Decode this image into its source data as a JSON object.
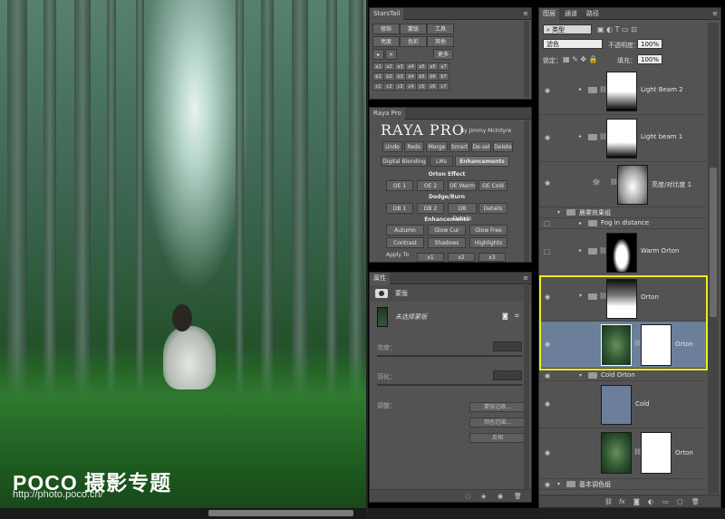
{
  "photo": {
    "watermark_logo": "POCO 摄影专题",
    "watermark_url": "http://photo.poco.cn/"
  },
  "starstail": {
    "title": "StarsTail",
    "row1": [
      "修饰",
      "蒙版",
      "工具"
    ],
    "row2": [
      "亮度",
      "色彩",
      "其他"
    ],
    "more": "更多",
    "grid_labels": [
      "a1",
      "a2",
      "a3",
      "a4",
      "a5",
      "a6",
      "a7",
      "b1",
      "b2",
      "b3",
      "b4",
      "b5",
      "b6",
      "b7",
      "c1",
      "c2",
      "c3",
      "c4",
      "c5",
      "c6",
      "c7"
    ]
  },
  "raya": {
    "tab": "Raya Pro",
    "title": "RAYA PRO",
    "by": "By Jimmy McIntyre",
    "top_buttons": [
      "Undo",
      "Redo",
      "Merge",
      "Smart",
      "De-sel",
      "Delete"
    ],
    "tabs": [
      "Digital Blending",
      "LMs",
      "Enhancements"
    ],
    "orton_label": "Orton Effect",
    "orton_buttons": [
      "OE 1",
      "OE 2",
      "OE Warm",
      "OE Cold"
    ],
    "dodge_label": "Dodge/Burn",
    "dodge_buttons": [
      "DB 1",
      "DB 2",
      "DB Details",
      "Details"
    ],
    "enh_label": "Enhancements",
    "enh_row1": [
      "Autumn",
      "Glow Cur",
      "Glow Free"
    ],
    "enh_row2": [
      "Contrast",
      "Shadows",
      "Highlights"
    ],
    "apply_to": "Apply To",
    "apply_buttons": [
      "x1",
      "x2",
      "x3"
    ]
  },
  "props": {
    "tab": "属性",
    "mask_type": "蒙版",
    "mask_name": "未选择蒙版",
    "density": "浓度：",
    "feather": "羽化：",
    "adjust": "调整：",
    "btn_edge": "蒙版边缘...",
    "btn_range": "颜色范围...",
    "btn_invert": "反相"
  },
  "layers": {
    "tabs": [
      "图层",
      "通道",
      "路径"
    ],
    "filter": "类型",
    "blend_mode": "滤色",
    "opacity_label": "不透明度：",
    "opacity_value": "100%",
    "lock_label": "锁定：",
    "fill_label": "填充：",
    "fill_value": "100%",
    "rows": {
      "light_beam_2": "Light Beam 2",
      "light_beam_1": "Light beam 1",
      "brightness": "亮度/对比度 1",
      "fog_group": "晨雾效果组",
      "fog_distance": "Fog in distance",
      "warm_orton": "Warm Orton",
      "orton_group": "Orton",
      "orton_layer": "Orton",
      "cold_orton_group": "Cold Orton",
      "cold": "Cold",
      "orton_bottom": "Orton",
      "base_group": "基本调色组"
    }
  },
  "colors": {
    "highlight": "#f1ea19",
    "selected_row": "#6b7f9a",
    "panel_bg": "#535353"
  }
}
